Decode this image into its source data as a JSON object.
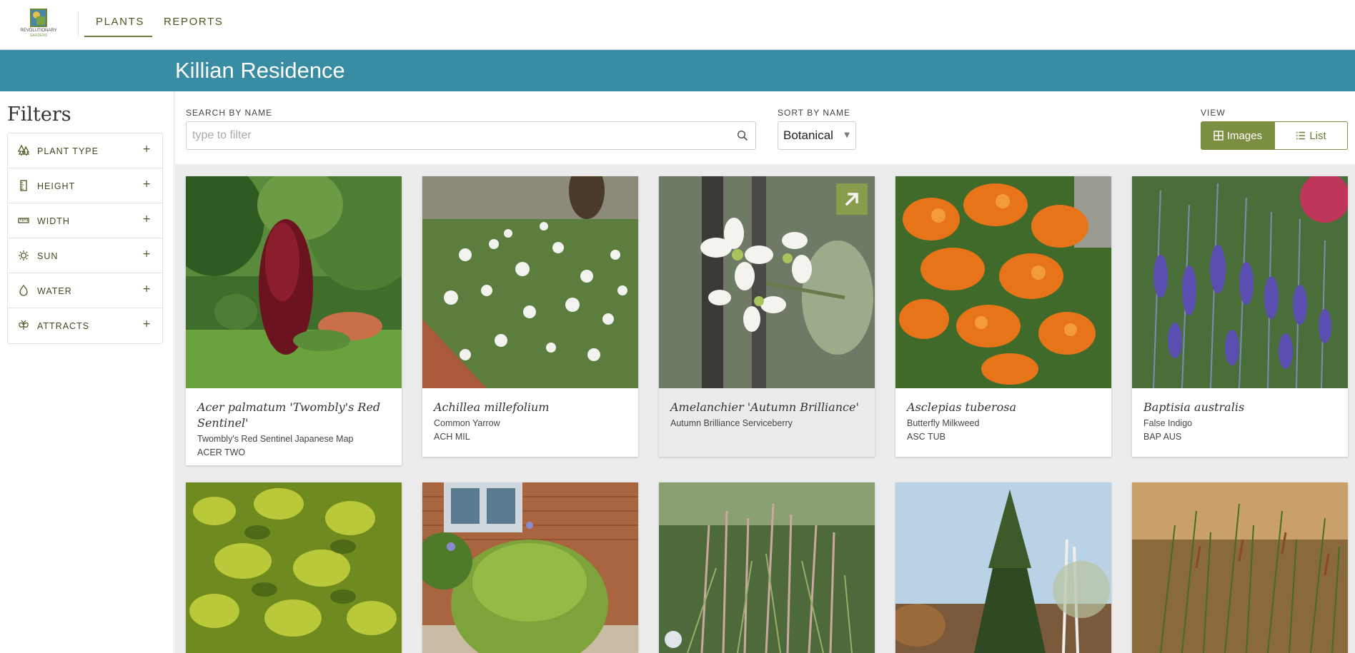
{
  "nav": {
    "logo_text": "REVOLUTIONARY",
    "logo_sub": "GARDENS",
    "tabs": [
      {
        "label": "PLANTS",
        "active": true
      },
      {
        "label": "REPORTS",
        "active": false
      }
    ]
  },
  "banner": {
    "title": "Killian Residence"
  },
  "sidebar": {
    "title": "Filters",
    "filters": [
      {
        "label": "PLANT TYPE",
        "icon": "trees-icon"
      },
      {
        "label": "HEIGHT",
        "icon": "ruler-vertical-icon"
      },
      {
        "label": "WIDTH",
        "icon": "ruler-horizontal-icon"
      },
      {
        "label": "SUN",
        "icon": "sun-icon"
      },
      {
        "label": "WATER",
        "icon": "droplet-icon"
      },
      {
        "label": "ATTRACTS",
        "icon": "butterfly-icon"
      }
    ],
    "expand_symbol": "+"
  },
  "controls": {
    "search_label": "SEARCH BY NAME",
    "search_placeholder": "type to filter",
    "search_value": "",
    "sort_label": "SORT BY NAME",
    "sort_value": "Botanical",
    "view_label": "VIEW",
    "view_images": "Images",
    "view_list": "List"
  },
  "plants": [
    {
      "botanical": "Acer palmatum 'Twombly's Red Sentinel'",
      "common": "Twombly's Red Sentinel Japanese Map",
      "code": "ACER TWO"
    },
    {
      "botanical": "Achillea millefolium",
      "common": "Common Yarrow",
      "code": "ACH MIL"
    },
    {
      "botanical": "Amelanchier 'Autumn Brilliance'",
      "common": "Autumn Brilliance Serviceberry",
      "code": ""
    },
    {
      "botanical": "Asclepias tuberosa",
      "common": "Butterfly Milkweed",
      "code": "ASC TUB"
    },
    {
      "botanical": "Baptisia australis",
      "common": "False Indigo",
      "code": "BAP AUS"
    }
  ],
  "colors": {
    "banner": "#388ca3",
    "accent": "#7a8f42",
    "nav_text": "#4b5a22"
  }
}
